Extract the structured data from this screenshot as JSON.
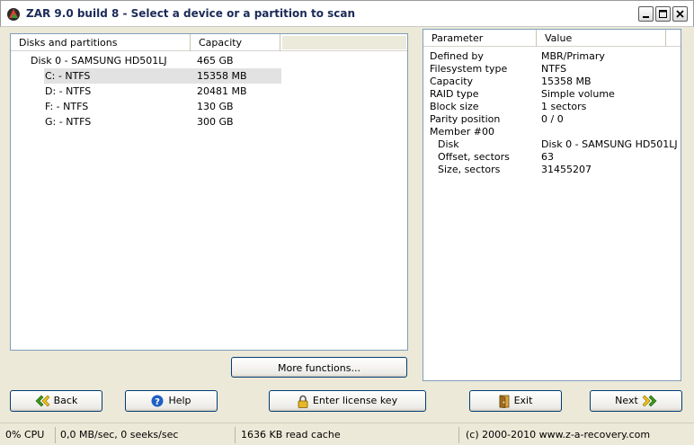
{
  "window": {
    "title": "ZAR 9.0 build 8 - Select a device or a partition to scan"
  },
  "left_panel": {
    "columns": [
      "Disks and partitions",
      "Capacity"
    ],
    "rows": [
      {
        "name": "Disk 0 - SAMSUNG HD501LJ",
        "capacity": "465 GB",
        "selected": false,
        "indent": 0
      },
      {
        "name": "C: - NTFS",
        "capacity": "15358 MB",
        "selected": true,
        "indent": 1
      },
      {
        "name": "D: - NTFS",
        "capacity": "20481 MB",
        "selected": false,
        "indent": 1
      },
      {
        "name": "F: - NTFS",
        "capacity": "130 GB",
        "selected": false,
        "indent": 1
      },
      {
        "name": "G: - NTFS",
        "capacity": "300 GB",
        "selected": false,
        "indent": 1
      }
    ],
    "more_functions_label": "More functions..."
  },
  "right_panel": {
    "columns": [
      "Parameter",
      "Value"
    ],
    "rows": [
      {
        "param": "Defined by",
        "value": "MBR/Primary",
        "indent": 0
      },
      {
        "param": "Filesystem type",
        "value": "NTFS",
        "indent": 0
      },
      {
        "param": "Capacity",
        "value": "15358 MB",
        "indent": 0
      },
      {
        "param": "RAID type",
        "value": "Simple volume",
        "indent": 0
      },
      {
        "param": "Block size",
        "value": "1 sectors",
        "indent": 0
      },
      {
        "param": "Parity position",
        "value": "0 / 0",
        "indent": 0
      },
      {
        "param": "Member #00",
        "value": "",
        "indent": 0
      },
      {
        "param": "Disk",
        "value": "Disk 0 - SAMSUNG HD501LJ",
        "indent": 1
      },
      {
        "param": "Offset, sectors",
        "value": "63",
        "indent": 1
      },
      {
        "param": "Size, sectors",
        "value": "31455207",
        "indent": 1
      }
    ]
  },
  "buttons": {
    "back": "Back",
    "help": "Help",
    "license": "Enter license key",
    "exit": "Exit",
    "next": "Next"
  },
  "statusbar": {
    "cpu": "0% CPU",
    "io": "0,0 MB/sec, 0 seeks/sec",
    "cache": "1636 KB read cache",
    "copyright": "(c) 2000-2010 www.z-a-recovery.com"
  },
  "icons": {
    "app": "zar-app-icon",
    "back": "double-chevron-left-icon",
    "help": "question-icon",
    "license": "padlock-icon",
    "exit": "exit-door-icon",
    "next": "double-chevron-right-icon"
  },
  "colors": {
    "title_text": "#1b2a58",
    "selection": "#e2e2e2",
    "panel_border": "#7f9db9",
    "chevron_green": "#3a9a1a",
    "help_blue": "#1f5fc4"
  }
}
